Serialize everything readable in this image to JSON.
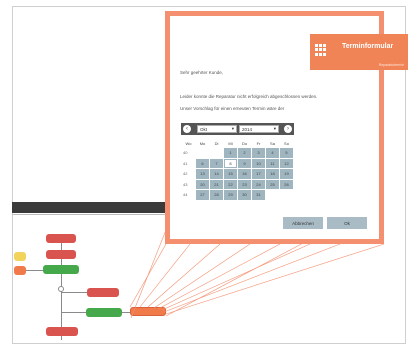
{
  "header": {
    "title": "Terminformular",
    "subtitle": "Reparaturtermin"
  },
  "dialog": {
    "greeting": "Sehr geehrter Kunde,",
    "line1": "Leider konnte die Reparatur nicht erfolgreich abgeschlossen werden.",
    "line2": "Unser Vorschlag für einen erneuten Termin wäre der"
  },
  "calendar": {
    "prev_icon": "chevron-left-icon",
    "next_icon": "chevron-right-icon",
    "month": "Okt",
    "year": "2014",
    "weekdays": [
      "Wo",
      "Mo",
      "Di",
      "Mi",
      "Do",
      "Fr",
      "Sa",
      "So"
    ],
    "weeks": [
      {
        "wk": "40",
        "days": [
          "",
          "",
          "",
          "1",
          "2",
          "3",
          "4",
          "5"
        ]
      },
      {
        "wk": "41",
        "days": [
          "",
          "6",
          "7",
          "8",
          "9",
          "10",
          "11",
          "12"
        ]
      },
      {
        "wk": "42",
        "days": [
          "",
          "13",
          "14",
          "15",
          "16",
          "17",
          "18",
          "19"
        ]
      },
      {
        "wk": "43",
        "days": [
          "",
          "20",
          "21",
          "22",
          "23",
          "24",
          "25",
          "26"
        ]
      },
      {
        "wk": "44",
        "days": [
          "",
          "27",
          "28",
          "29",
          "30",
          "31",
          "",
          ""
        ]
      }
    ],
    "today": "8"
  },
  "buttons": {
    "cancel": "Abbrechen",
    "ok": "Ok"
  },
  "colors": {
    "accent": "#f08457",
    "calendar_cell": "#9fb5bf"
  }
}
